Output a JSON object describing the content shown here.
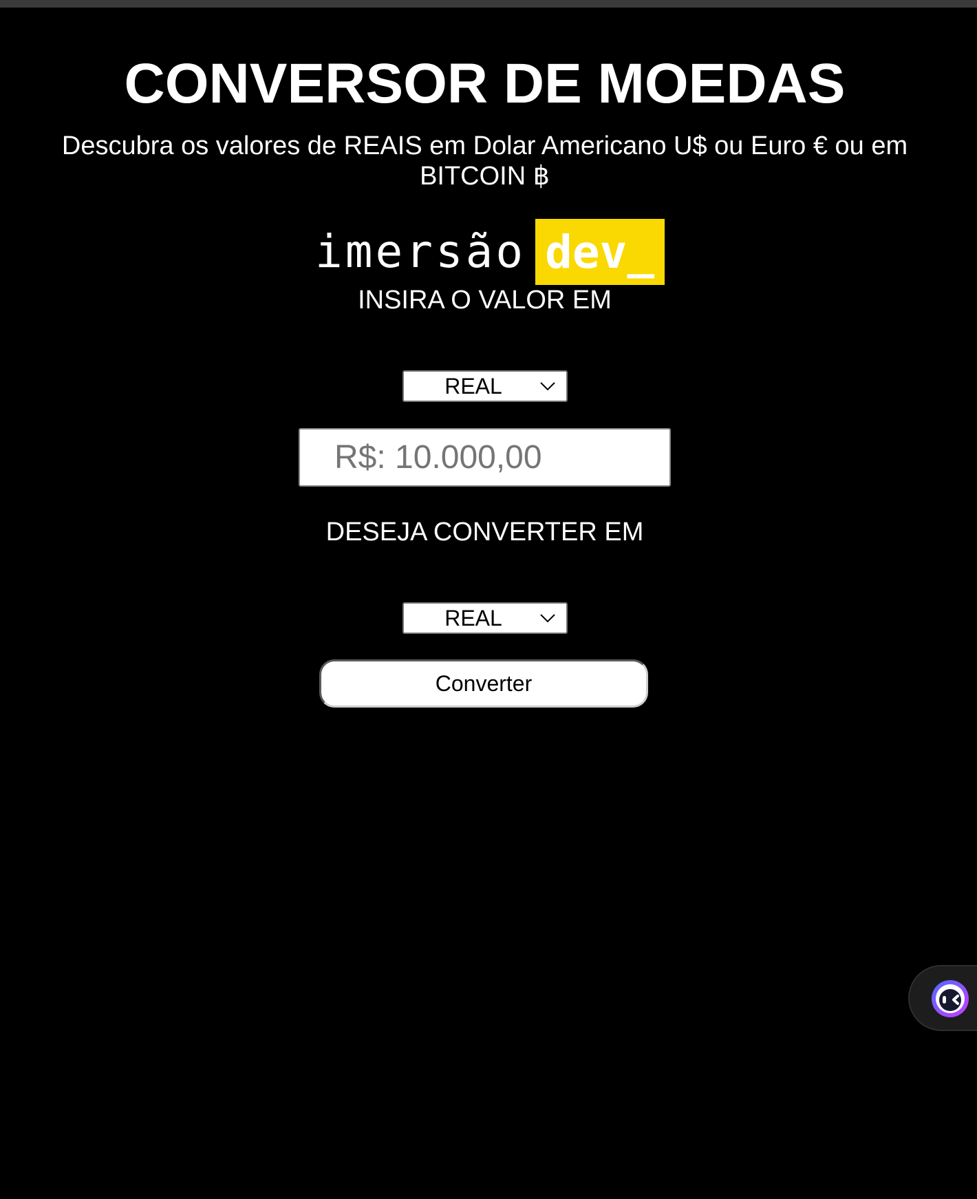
{
  "header": {
    "title": "CONVERSOR DE MOEDAS",
    "subtitle": "Descubra os valores de REAIS em Dolar Americano U$ ou Euro € ou em BITCOIN ฿"
  },
  "logo": {
    "word": "imersão",
    "badge": "dev_",
    "badge_color": "#f9d901"
  },
  "converter": {
    "from_label": "INSIRA O VALOR EM",
    "from_currency": "REAL",
    "amount_placeholder": "R$: 10.000,00",
    "to_label": "DESEJA CONVERTER EM",
    "to_currency": "REAL",
    "button_label": "Converter"
  },
  "widgets": {
    "assistant_icon": "assistant-face-icon"
  },
  "colors": {
    "background": "#000000",
    "text": "#ffffff",
    "accent": "#f9d901"
  }
}
